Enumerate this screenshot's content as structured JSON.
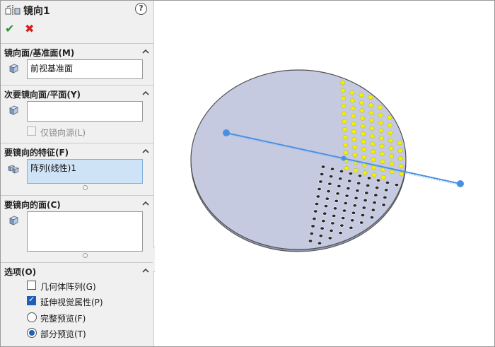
{
  "feature": {
    "title": "镜向1",
    "title_icon": "mirror-feature-icon",
    "help_icon": "question-mark-icon",
    "ok_icon": "checkmark-icon",
    "cancel_icon": "x-icon"
  },
  "sections": {
    "mirror_face": {
      "title": "镜向面/基准面(M)",
      "value": "前视基准面"
    },
    "secondary_mirror": {
      "title": "次要镜向面/平面(Y)",
      "value": "",
      "option_label": "仅镜向源(L)",
      "option_checked": false,
      "option_enabled": false
    },
    "features_to_mirror": {
      "title": "要镜向的特征(F)",
      "value": "阵列(线性)1"
    },
    "faces_to_mirror": {
      "title": "要镜向的面(C)",
      "value": ""
    },
    "options": {
      "title": "选项(O)",
      "geometry_pattern": {
        "label": "几何体阵列(G)",
        "checked": false
      },
      "propagate_visual": {
        "label": "延伸视觉属性(P)",
        "checked": true
      },
      "preview_full": {
        "label": "完整预览(F)",
        "selected": false
      },
      "preview_partial": {
        "label": "部分预览(T)",
        "selected": true
      }
    }
  },
  "colors": {
    "disk_fill": "#c5cae0",
    "disk_edge": "#505050",
    "hole_source": "#f2f200",
    "plane_line": "#4a90e2",
    "selection_bg": "#cfe3f7"
  }
}
